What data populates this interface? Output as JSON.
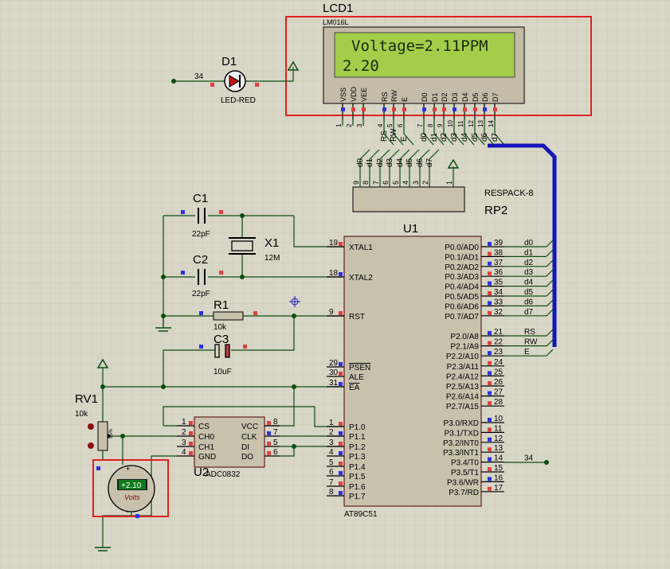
{
  "lcd": {
    "ref": "LCD1",
    "model": "LM016L",
    "line1": "Voltage=2.11PPM",
    "line2": "2.20",
    "pins": [
      "VSS",
      "VDD",
      "VEE",
      "RS",
      "RW",
      "E",
      "D0",
      "D1",
      "D2",
      "D3",
      "D4",
      "D5",
      "D6",
      "D7"
    ],
    "pin_numbers": [
      "1",
      "2",
      "3",
      "4",
      "5",
      "6",
      "7",
      "8",
      "9",
      "10",
      "11",
      "12",
      "13",
      "14"
    ],
    "net_labels": [
      "RS",
      "RW",
      "E",
      "d0",
      "d1",
      "d2",
      "d3",
      "d4",
      "d5",
      "d6",
      "d7"
    ]
  },
  "led": {
    "ref": "D1",
    "type": "LED-RED",
    "net": "34"
  },
  "respack": {
    "model": "RESPACK-8",
    "ref": "RP2",
    "nets": [
      "d0",
      "d1",
      "d2",
      "d3",
      "d4",
      "d5",
      "d6",
      "d7"
    ],
    "pins": [
      "9",
      "8",
      "7",
      "6",
      "5",
      "4",
      "3",
      "2",
      "1"
    ]
  },
  "c1": {
    "ref": "C1",
    "value": "22pF"
  },
  "c2": {
    "ref": "C2",
    "value": "22pF"
  },
  "x1": {
    "ref": "X1",
    "value": "12M"
  },
  "r1": {
    "ref": "R1",
    "value": "10k"
  },
  "c3": {
    "ref": "C3",
    "value": "10uF"
  },
  "rv1": {
    "ref": "RV1",
    "value": "10k",
    "readout": "+2.10",
    "unit": "Volts",
    "cursor": "95%"
  },
  "u2": {
    "ref": "U2",
    "model": "ADC0832",
    "left_pins": [
      {
        "num": "1",
        "name": "CS"
      },
      {
        "num": "2",
        "name": "CH0"
      },
      {
        "num": "3",
        "name": "CH1"
      },
      {
        "num": "4",
        "name": "GND"
      }
    ],
    "right_pins": [
      {
        "num": "8",
        "name": "VCC"
      },
      {
        "num": "7",
        "name": "CLK"
      },
      {
        "num": "5",
        "name": "DI"
      },
      {
        "num": "6",
        "name": "DO"
      }
    ]
  },
  "u1": {
    "ref": "U1",
    "model": "AT89C51",
    "left_pins": [
      {
        "num": "19",
        "name": "XTAL1"
      },
      {
        "num": "18",
        "name": "XTAL2"
      },
      {
        "num": "9",
        "name": "RST"
      },
      {
        "num": "29",
        "name": "PSEN"
      },
      {
        "num": "30",
        "name": "ALE"
      },
      {
        "num": "31",
        "name": "EA"
      },
      {
        "num": "1",
        "name": "P1.0"
      },
      {
        "num": "2",
        "name": "P1.1"
      },
      {
        "num": "3",
        "name": "P1.2"
      },
      {
        "num": "4",
        "name": "P1.3"
      },
      {
        "num": "5",
        "name": "P1.4"
      },
      {
        "num": "6",
        "name": "P1.5"
      },
      {
        "num": "7",
        "name": "P1.6"
      },
      {
        "num": "8",
        "name": "P1.7"
      }
    ],
    "right_pins": [
      {
        "num": "39",
        "name": "P0.0/AD0",
        "net": "d0"
      },
      {
        "num": "38",
        "name": "P0.1/AD1",
        "net": "d1"
      },
      {
        "num": "37",
        "name": "P0.2/AD2",
        "net": "d2"
      },
      {
        "num": "36",
        "name": "P0.3/AD3",
        "net": "d3"
      },
      {
        "num": "35",
        "name": "P0.4/AD4",
        "net": "d4"
      },
      {
        "num": "34",
        "name": "P0.5/AD5",
        "net": "d5"
      },
      {
        "num": "33",
        "name": "P0.6/AD6",
        "net": "d6"
      },
      {
        "num": "32",
        "name": "P0.7/AD7",
        "net": "d7"
      },
      {
        "num": "21",
        "name": "P2.0/A8",
        "net": "RS"
      },
      {
        "num": "22",
        "name": "P2.1/A9",
        "net": "RW"
      },
      {
        "num": "23",
        "name": "P2.2/A10",
        "net": "E"
      },
      {
        "num": "24",
        "name": "P2.3/A11",
        "net": ""
      },
      {
        "num": "25",
        "name": "P2.4/A12",
        "net": ""
      },
      {
        "num": "26",
        "name": "P2.5/A13",
        "net": ""
      },
      {
        "num": "27",
        "name": "P2.6/A14",
        "net": ""
      },
      {
        "num": "28",
        "name": "P2.7/A15",
        "net": ""
      },
      {
        "num": "10",
        "name": "P3.0/RXD",
        "net": ""
      },
      {
        "num": "11",
        "name": "P3.1/TXD",
        "net": ""
      },
      {
        "num": "12",
        "name": "P3.2/INT0",
        "net": ""
      },
      {
        "num": "13",
        "name": "P3.3/INT1",
        "net": ""
      },
      {
        "num": "14",
        "name": "P3.4/T0",
        "net": "34"
      },
      {
        "num": "15",
        "name": "P3.5/T1",
        "net": ""
      },
      {
        "num": "16",
        "name": "P3.6/WR",
        "net": ""
      },
      {
        "num": "17",
        "name": "P3.7/RD",
        "net": ""
      }
    ]
  },
  "colors": {
    "background": "#d8d6c6",
    "wire": "#0b4e12",
    "bus": "#1414b8",
    "selection": "#e02020",
    "lcd_screen": "#a4cd4a",
    "component_body": "#c8c1ac"
  }
}
